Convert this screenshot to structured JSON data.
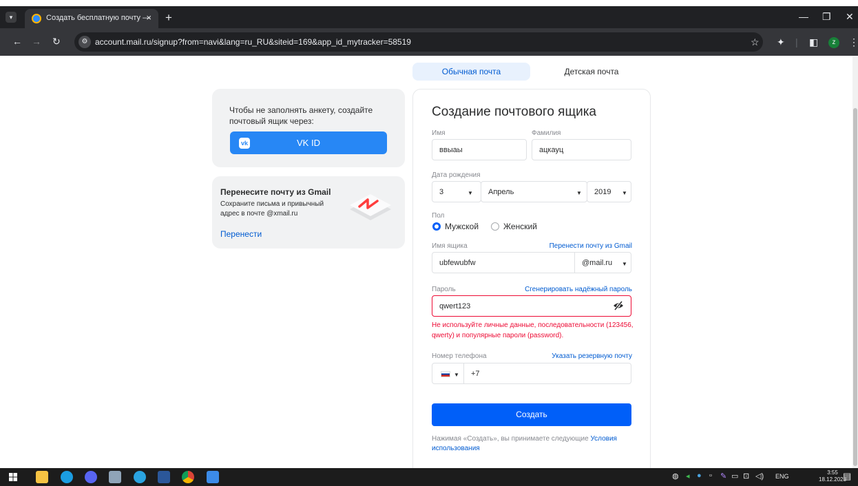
{
  "browser": {
    "tab_title": "Создать бесплатную почту —",
    "tab_close": "×",
    "new_tab": "+",
    "url": "account.mail.ru/signup?from=navi&lang=ru_RU&siteid=169&app_id_mytracker=58519",
    "profile_initial": "z"
  },
  "mail_tabs": {
    "regular": "Обычная почта",
    "kids": "Детская почта"
  },
  "vk_card": {
    "text": "Чтобы не заполнять анкету, создайте почтовый ящик через:",
    "button_label": "VK ID"
  },
  "gmail_card": {
    "title": "Перенесите почту из Gmail",
    "description": "Сохраните письма и привычный адрес в почте @xmail.ru",
    "link": "Перенести"
  },
  "form": {
    "title": "Создание почтового ящика",
    "first_name": {
      "label": "Имя",
      "value": "ввыаы"
    },
    "last_name": {
      "label": "Фамилия",
      "value": "ацкауц"
    },
    "birth_date": {
      "label": "Дата рождения",
      "day": "3",
      "month": "Апрель",
      "year": "2019"
    },
    "gender": {
      "label": "Пол",
      "male": "Мужской",
      "female": "Женский",
      "selected": "male"
    },
    "mailbox": {
      "label": "Имя ящика",
      "link": "Перенести почту из Gmail",
      "value": "ubfewubfw",
      "domain": "@mail.ru"
    },
    "password": {
      "label": "Пароль",
      "link": "Сгенерировать надёжный пароль",
      "value": "qwert123",
      "error": "Не используйте личные данные, последовательности (123456, qwerty) и популярные пароли (password)."
    },
    "phone": {
      "label": "Номер телефона",
      "link": "Указать резервную почту",
      "prefix": "+7"
    },
    "submit_label": "Создать",
    "terms_text": "Нажимая «Создать», вы принимаете следующие",
    "terms_link": "Условия использования"
  },
  "taskbar": {
    "lang": "ENG",
    "time": "3:55",
    "date": "18.12.2023"
  }
}
